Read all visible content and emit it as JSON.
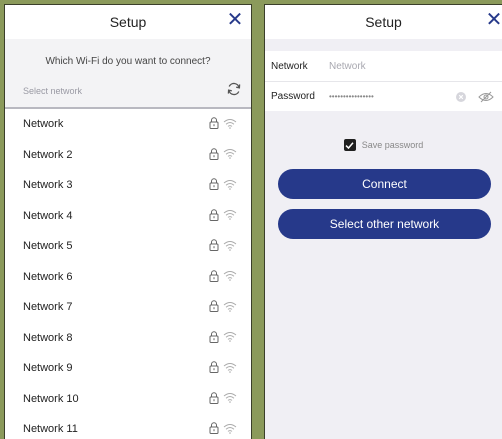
{
  "left": {
    "title": "Setup",
    "close_glyph": "✕",
    "question": "Which Wi-Fi do you want to connect?",
    "select_label": "Select network",
    "networks": [
      {
        "name": "Network"
      },
      {
        "name": "Network 2"
      },
      {
        "name": "Network 3"
      },
      {
        "name": "Network 4"
      },
      {
        "name": "Network 5"
      },
      {
        "name": "Network 6"
      },
      {
        "name": "Network 7"
      },
      {
        "name": "Network 8"
      },
      {
        "name": "Network 9"
      },
      {
        "name": "Network 10"
      },
      {
        "name": "Network 11"
      }
    ]
  },
  "right": {
    "title": "Setup",
    "close_glyph": "✕",
    "network_label": "Network",
    "network_placeholder": "Network",
    "password_label": "Password",
    "password_masked": "••••••••••••••••",
    "save_password_label": "Save password",
    "save_password_checked": true,
    "connect_label": "Connect",
    "other_network_label": "Select other network"
  },
  "colors": {
    "accent": "#26398a",
    "background": "#8b9a5b"
  },
  "icons": {
    "refresh": "refresh-icon",
    "lock": "lock-icon",
    "wifi": "wifi-icon",
    "clear": "clear-icon",
    "eye": "eye-off-icon",
    "close": "close-icon",
    "check": "checkmark-icon"
  }
}
